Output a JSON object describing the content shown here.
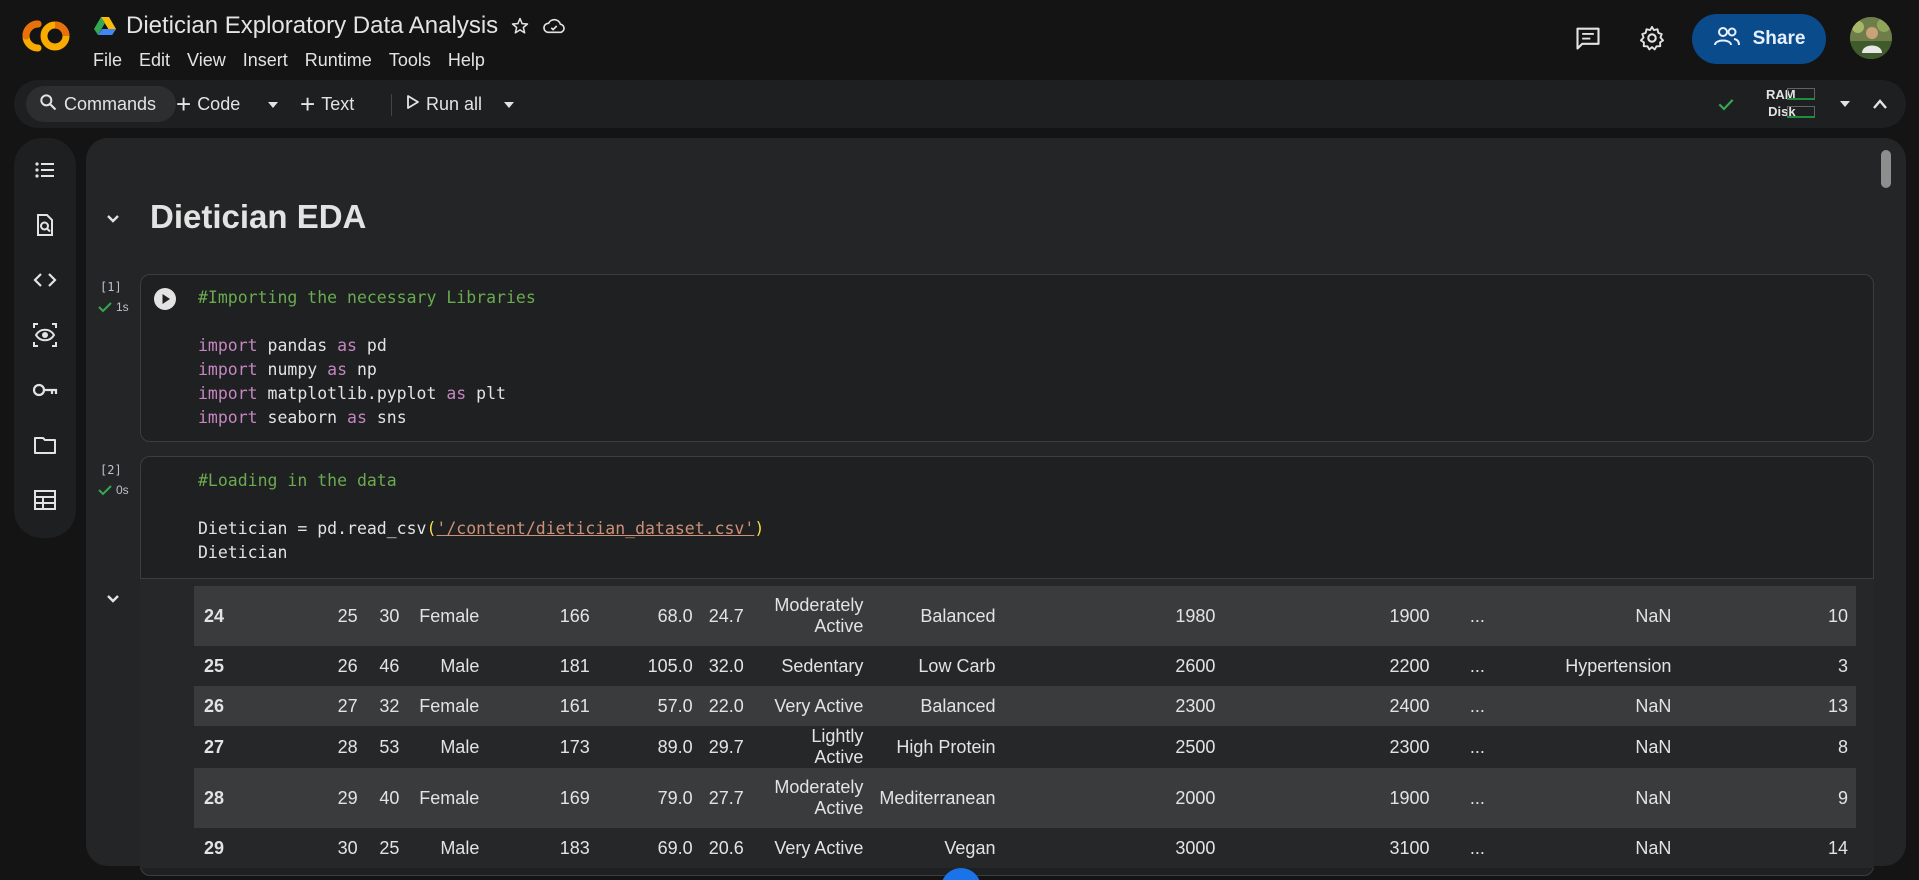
{
  "header": {
    "title": "Dietician Exploratory Data Analysis",
    "menu": [
      "File",
      "Edit",
      "View",
      "Insert",
      "Runtime",
      "Tools",
      "Help"
    ],
    "share_label": "Share"
  },
  "toolbar": {
    "commands_label": "Commands",
    "code_label": "Code",
    "text_label": "Text",
    "run_all_label": "Run all",
    "ram_label": "RAM",
    "disk_label": "Disk"
  },
  "notebook": {
    "heading": "Dietician EDA",
    "cell1": {
      "exec_count": "[1]",
      "exec_time": "1s",
      "comment": "#Importing the necessary Libraries",
      "lines": [
        {
          "kw1": "import",
          "mod": " pandas ",
          "kw2": "as",
          "alias": " pd"
        },
        {
          "kw1": "import",
          "mod": " numpy ",
          "kw2": "as",
          "alias": " np"
        },
        {
          "kw1": "import",
          "mod": " matplotlib.pyplot ",
          "kw2": "as",
          "alias": " plt"
        },
        {
          "kw1": "import",
          "mod": " seaborn ",
          "kw2": "as",
          "alias": " sns"
        }
      ]
    },
    "cell2": {
      "exec_count": "[2]",
      "exec_time": "0s",
      "comment": "#Loading in the data",
      "assign": "Dietician = pd.read_csv",
      "open_paren": "(",
      "path": "'/content/dietician_dataset.csv'",
      "close_paren": ")",
      "var": "Dietician"
    },
    "table": {
      "rows": [
        [
          "24",
          "25",
          "30",
          "Female",
          "166",
          "68.0",
          "24.7",
          "Moderately Active",
          "Balanced",
          "1980",
          "1900",
          "...",
          "NaN",
          "10"
        ],
        [
          "25",
          "26",
          "46",
          "Male",
          "181",
          "105.0",
          "32.0",
          "Sedentary",
          "Low Carb",
          "2600",
          "2200",
          "...",
          "Hypertension",
          "3"
        ],
        [
          "26",
          "27",
          "32",
          "Female",
          "161",
          "57.0",
          "22.0",
          "Very Active",
          "Balanced",
          "2300",
          "2400",
          "...",
          "NaN",
          "13"
        ],
        [
          "27",
          "28",
          "53",
          "Male",
          "173",
          "89.0",
          "29.7",
          "Lightly Active",
          "High Protein",
          "2500",
          "2300",
          "...",
          "NaN",
          "8"
        ],
        [
          "28",
          "29",
          "40",
          "Female",
          "169",
          "79.0",
          "27.7",
          "Moderately Active",
          "Mediterranean",
          "2000",
          "1900",
          "...",
          "NaN",
          "9"
        ],
        [
          "29",
          "30",
          "25",
          "Male",
          "183",
          "69.0",
          "20.6",
          "Very Active",
          "Vegan",
          "3000",
          "3100",
          "...",
          "NaN",
          "14"
        ]
      ]
    }
  },
  "colors": {
    "accent": "#0a4b8c",
    "success": "#34a853",
    "background": "#141414",
    "panel": "#242526"
  }
}
